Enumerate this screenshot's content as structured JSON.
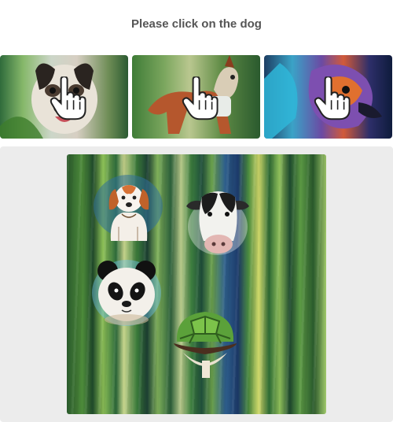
{
  "prompt": "Please click on the dog",
  "examples": [
    {
      "subject": "dog",
      "icon": "hand-pointer-icon"
    },
    {
      "subject": "dog",
      "icon": "hand-pointer-icon"
    },
    {
      "subject": "dog",
      "icon": "hand-pointer-icon"
    }
  ],
  "canvas": {
    "targets": [
      "dog",
      "cow",
      "panda",
      "turtle"
    ]
  },
  "colors": {
    "prompt_text": "#555555",
    "panel_background": "#ececec",
    "page_background": "#ffffff"
  }
}
